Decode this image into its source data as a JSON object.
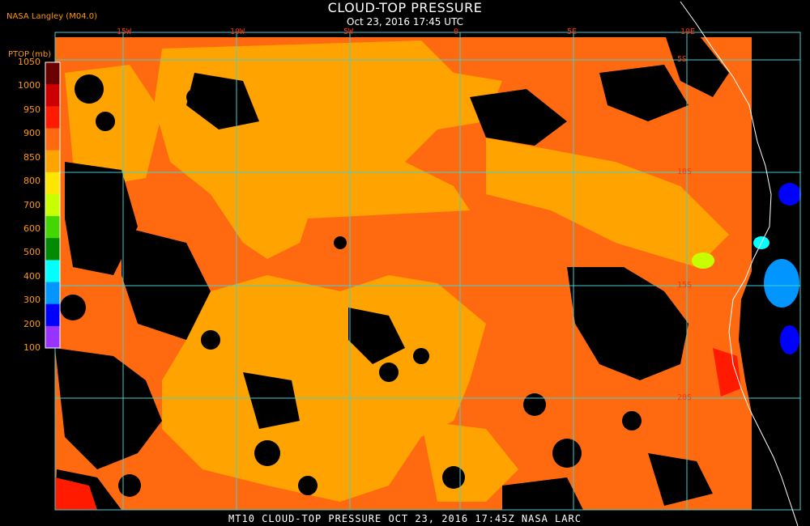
{
  "header": {
    "title": "CLOUD-TOP PRESSURE",
    "subtitle": "Oct 23, 2016 17:45 UTC",
    "producer": "NASA Langley (M04.0)"
  },
  "footer": {
    "text": "MT10  CLOUD-TOP PRESSURE  OCT 23, 2016 17:45Z  NASA LARC"
  },
  "legend": {
    "title": "PTOP (mb)",
    "ticks": [
      "1050",
      "1000",
      "950",
      "900",
      "850",
      "800",
      "700",
      "600",
      "500",
      "400",
      "300",
      "200",
      "100"
    ],
    "colors": [
      "#6b0000",
      "#cc0000",
      "#ff1a00",
      "#ff6a10",
      "#ffa300",
      "#ffe600",
      "#c8ff00",
      "#44d600",
      "#008a00",
      "#00ffff",
      "#0095ff",
      "#0000ff",
      "#9933ff"
    ]
  },
  "grid": {
    "longitudes": [
      "15W",
      "10W",
      "5W",
      "0",
      "5E",
      "10E"
    ],
    "latitudes": [
      "5S",
      "10S",
      "15S",
      "20S"
    ]
  },
  "colors": {
    "grid": "#40d0d0",
    "coast": "#ffffff",
    "cloud_low": "#ffa300",
    "cloud_mid": "#ff6a10",
    "cloud_high": "#ff1a00"
  }
}
